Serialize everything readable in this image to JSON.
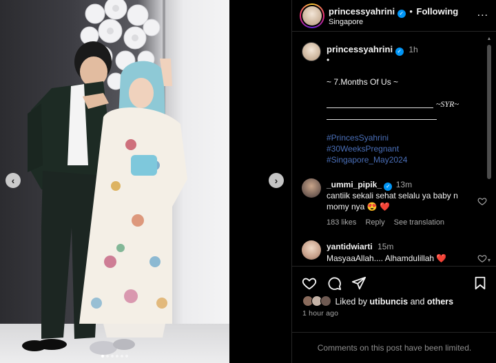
{
  "post": {
    "image_alt": "",
    "carousel": {
      "dot_count": 6,
      "active_index": 0
    }
  },
  "header": {
    "username": "princessyahrini",
    "separator": "•",
    "follow_status": "Following",
    "location": "Singapore",
    "more": "..."
  },
  "caption": {
    "username": "princessyahrini",
    "time": "1h",
    "lines": [
      "•",
      "~ 7.Months Of Us ~",
      "~SYR~"
    ],
    "hashtags": [
      "#PrincesSyahrini",
      "#30WeeksPregnant",
      "#Singapore_May2024"
    ]
  },
  "comments": [
    {
      "username": "_ummi_pipik_",
      "verified": true,
      "time": "13m",
      "text": "cantiik sekali sehat selalu ya baby n momy nya 😍 ❤️",
      "likes": "183 likes",
      "reply": "Reply",
      "see_translation": "See translation"
    },
    {
      "username": "yantidwiarti",
      "verified": false,
      "time": "15m",
      "text": "MasyaaAllah.... Alhamdulillah ❤️"
    }
  ],
  "likes_summary": {
    "prefix": "Liked by",
    "user": "utibuncis",
    "connector": "and",
    "others": "others"
  },
  "timestamp": "1 hour ago",
  "comments_notice": "Comments on this post have been limited.",
  "colors": {
    "accent": "#0095f6",
    "hashtag": "#4a6fb8",
    "heart": "#ed4956",
    "background": "#000000"
  }
}
